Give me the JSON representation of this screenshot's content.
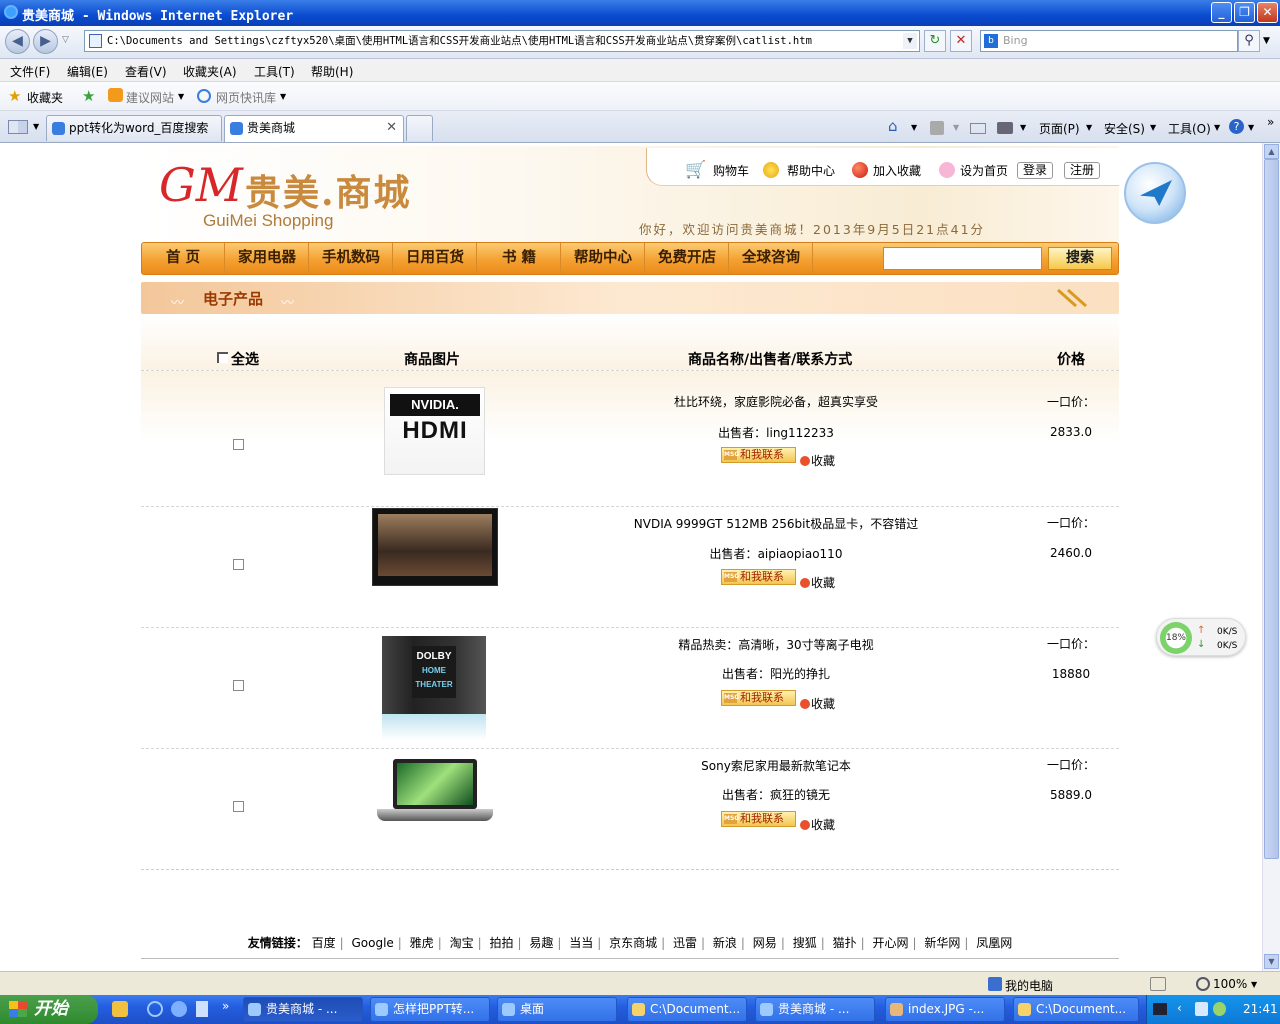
{
  "window": {
    "title": "贵美商城 - Windows Internet Explorer"
  },
  "browser": {
    "address": "C:\\Documents and Settings\\czftyx520\\桌面\\使用HTML语言和CSS开发商业站点\\使用HTML语言和CSS开发商业站点\\贯穿案例\\catlist.htm",
    "search_placeholder": "Bing",
    "menu": [
      "文件(F)",
      "编辑(E)",
      "查看(V)",
      "收藏夹(A)",
      "工具(T)",
      "帮助(H)"
    ],
    "favorites": {
      "label": "收藏夹",
      "suggested": "建议网站",
      "webslice": "网页快讯库"
    },
    "tabs": [
      {
        "label": "ppt转化为word_百度搜索"
      },
      {
        "label": "贵美商城"
      }
    ],
    "commands": [
      "页面(P)",
      "安全(S)",
      "工具(O)"
    ]
  },
  "site": {
    "logo_mark": "GM",
    "logo_cn": "贵美.商城",
    "logo_en": "GuiMei Shopping",
    "top_links": [
      "购物车",
      "帮助中心",
      "加入收藏",
      "设为首页"
    ],
    "login": "登录",
    "register": "注册",
    "welcome": "你好，欢迎访问贵美商城！2013年9月5日21点41分",
    "nav": [
      "首  页",
      "家用电器",
      "手机数码",
      "日用百货",
      "书  籍",
      "帮助中心",
      "免费开店",
      "全球咨询"
    ],
    "search_button": "搜索",
    "section_title": "电子产品",
    "columns": {
      "select_all": "全选",
      "image": "商品图片",
      "name": "商品名称/出售者/联系方式",
      "price": "价格"
    },
    "contact_label": "和我联系",
    "contact_badge": "MSG",
    "fav_label": "收藏",
    "seller_prefix": "出售者：",
    "price_prefix": "一口价：",
    "products": [
      {
        "title": "杜比环绕，家庭影院必备，超真实享受",
        "seller": "ling112233",
        "price": "2833.0"
      },
      {
        "title": "NVDIA 9999GT 512MB 256bit极品显卡，不容错过",
        "seller": "aipiaopiao110",
        "price": "2460.0"
      },
      {
        "title": "精品热卖：高清晰，30寸等离子电视",
        "seller": "阳光的挣扎",
        "price": "18880"
      },
      {
        "title": "Sony索尼家用最新款笔记本",
        "seller": "疯狂的镜无",
        "price": "5889.0"
      }
    ],
    "friend_label": "友情链接：",
    "friend_links": [
      "百度",
      "Google",
      "雅虎",
      "淘宝",
      "拍拍",
      "易趣",
      "当当",
      "京东商城",
      "迅雷",
      "新浪",
      "网易",
      "搜狐",
      "猫扑",
      "开心网",
      "新华网",
      "凤凰网"
    ]
  },
  "net_widget": {
    "percent": "18%",
    "up": "0K/S",
    "down": "0K/S"
  },
  "status": {
    "zone": "我的电脑",
    "zoom": "100%"
  },
  "taskbar": {
    "start": "开始",
    "items": [
      "贵美商城 - ...",
      "怎样把PPT转...",
      "桌面",
      "C:\\Document...",
      "贵美商城 - ...",
      "index.JPG -...",
      "C:\\Document..."
    ],
    "clock": "21:41"
  }
}
